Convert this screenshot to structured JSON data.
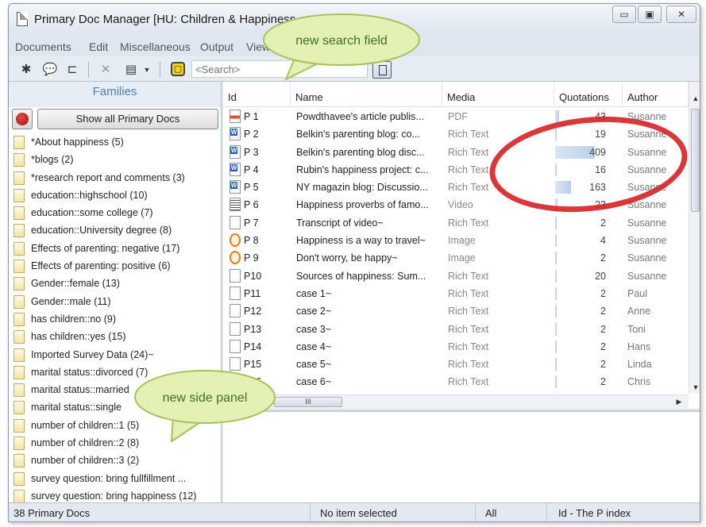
{
  "window": {
    "title": "Primary Doc Manager [HU: Children & Happiness",
    "minimize_glyph": "▭",
    "maximize_glyph": "▣",
    "close_glyph": "✕"
  },
  "menu": [
    "Documents",
    "Edit",
    "Miscellaneous",
    "Output",
    "View"
  ],
  "toolbar": {
    "search_placeholder": "<Search>"
  },
  "side_panel": {
    "header": "Families",
    "show_all_label": "Show all Primary Docs",
    "families": [
      "*About happiness (5)",
      "*blogs (2)",
      "*research report and comments (3)",
      "education::highschool (10)",
      "education::some college (7)",
      "education::University degree (8)",
      "Effects of parenting: negative (17)",
      "Effects of parenting: positive (6)",
      "Gender::female (13)",
      "Gender::male (11)",
      "has children::no (9)",
      "has children::yes (15)",
      "Imported Survey Data (24)~",
      "marital status::divorced (7)",
      "marital status::married",
      "marital status::single",
      "number of children::1 (5)",
      "number of children::2 (8)",
      "number of children::3 (2)",
      "survey question: bring fullfillment ...",
      "survey question: bring happiness (12)"
    ]
  },
  "table": {
    "columns": [
      "Id",
      "Name",
      "Media",
      "Quotations",
      "Author"
    ],
    "max_quotations": 409,
    "rows": [
      {
        "id": "P 1",
        "name": "Powdthavee's article publis...",
        "media": "PDF",
        "quotations": "43",
        "author": "Susanne",
        "icon": "pdf"
      },
      {
        "id": "P 2",
        "name": "Belkin's parenting blog: co...",
        "media": "Rich Text",
        "quotations": "19",
        "author": "Susanne",
        "icon": "word"
      },
      {
        "id": "P 3",
        "name": "Belkin's parenting blog disc...",
        "media": "Rich Text",
        "quotations": "409",
        "author": "Susanne",
        "icon": "word"
      },
      {
        "id": "P 4",
        "name": "Rubin's happiness project: c...",
        "media": "Rich Text",
        "quotations": "16",
        "author": "Susanne",
        "icon": "word"
      },
      {
        "id": "P 5",
        "name": "NY magazin blog: Discussio...",
        "media": "Rich Text",
        "quotations": "163",
        "author": "Susanne",
        "icon": "word"
      },
      {
        "id": "P 6",
        "name": "Happiness proverbs of famo...",
        "media": "Video",
        "quotations": "23",
        "author": "Susanne",
        "icon": "video"
      },
      {
        "id": "P 7",
        "name": "Transcript of video~",
        "media": "Rich Text",
        "quotations": "2",
        "author": "Susanne",
        "icon": "text"
      },
      {
        "id": "P 8",
        "name": "Happiness is a way to travel~",
        "media": "Image",
        "quotations": "4",
        "author": "Susanne",
        "icon": "image"
      },
      {
        "id": "P 9",
        "name": "Don't worry, be happy~",
        "media": "Image",
        "quotations": "2",
        "author": "Susanne",
        "icon": "image"
      },
      {
        "id": "P10",
        "name": "Sources of happiness: Sum...",
        "media": "Rich Text",
        "quotations": "20",
        "author": "Susanne",
        "icon": "text"
      },
      {
        "id": "P11",
        "name": "case 1~",
        "media": "Rich Text",
        "quotations": "2",
        "author": "Paul",
        "icon": "text"
      },
      {
        "id": "P12",
        "name": "case 2~",
        "media": "Rich Text",
        "quotations": "2",
        "author": "Anne",
        "icon": "text"
      },
      {
        "id": "P13",
        "name": "case 3~",
        "media": "Rich Text",
        "quotations": "2",
        "author": "Toni",
        "icon": "text"
      },
      {
        "id": "P14",
        "name": "case 4~",
        "media": "Rich Text",
        "quotations": "2",
        "author": "Hans",
        "icon": "text"
      },
      {
        "id": "P15",
        "name": "case 5~",
        "media": "Rich Text",
        "quotations": "2",
        "author": "Linda",
        "icon": "text"
      },
      {
        "id": "P16",
        "name": "case 6~",
        "media": "Rich Text",
        "quotations": "2",
        "author": "Chris",
        "icon": "text"
      }
    ]
  },
  "status": {
    "count": "38 Primary Docs",
    "selection": "No item selected",
    "filter": "All",
    "sort": "Id - The P index"
  },
  "annotations": {
    "search_callout": "new search field",
    "panel_callout": "new side panel"
  },
  "colors": {
    "callout_fill": "#d9eb9a",
    "callout_text": "#3f6f1f",
    "highlight_ring": "#d62628",
    "families_header": "#4f7fb4"
  }
}
